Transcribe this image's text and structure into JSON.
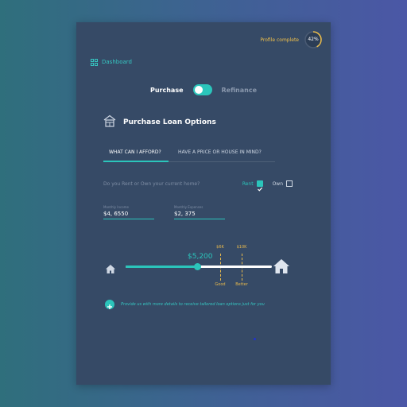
{
  "profile": {
    "label": "Profile complete",
    "percent_label": "42%",
    "percent": 42,
    "color": "#f0c04a"
  },
  "nav": {
    "dashboard": "Dashboard"
  },
  "mode": {
    "left": "Purchase",
    "right": "Refinance",
    "selected": "Purchase"
  },
  "section": {
    "title": "Purchase Loan Options",
    "icon": "house-icon"
  },
  "tabs": [
    {
      "label": "WHAT CAN I AFFORD?",
      "active": true
    },
    {
      "label": "HAVE A PRICE OR HOUSE IN MIND?",
      "active": false
    }
  ],
  "housing": {
    "question": "Do you Rent or Own your current home?",
    "options": [
      {
        "label": "Rent",
        "checked": true
      },
      {
        "label": "Own",
        "checked": false
      }
    ]
  },
  "fields": {
    "income": {
      "label": "Monthly Income",
      "value": "$4, 6550"
    },
    "expenses": {
      "label": "Monthly Expenses",
      "value": "$2, 375"
    }
  },
  "slider": {
    "value_label": "$5,200",
    "value": 5200,
    "fill_fraction": 0.49,
    "markers": [
      {
        "top": "$6K",
        "bottom": "Good",
        "value": 6000
      },
      {
        "top": "$10K",
        "bottom": "Better",
        "value": 10000
      }
    ]
  },
  "info": {
    "text": "Provide us with more details to receive tailored loan options just for you"
  },
  "colors": {
    "accent": "#2bc5bb",
    "card": "#364a66",
    "warning": "#e8b94d"
  }
}
